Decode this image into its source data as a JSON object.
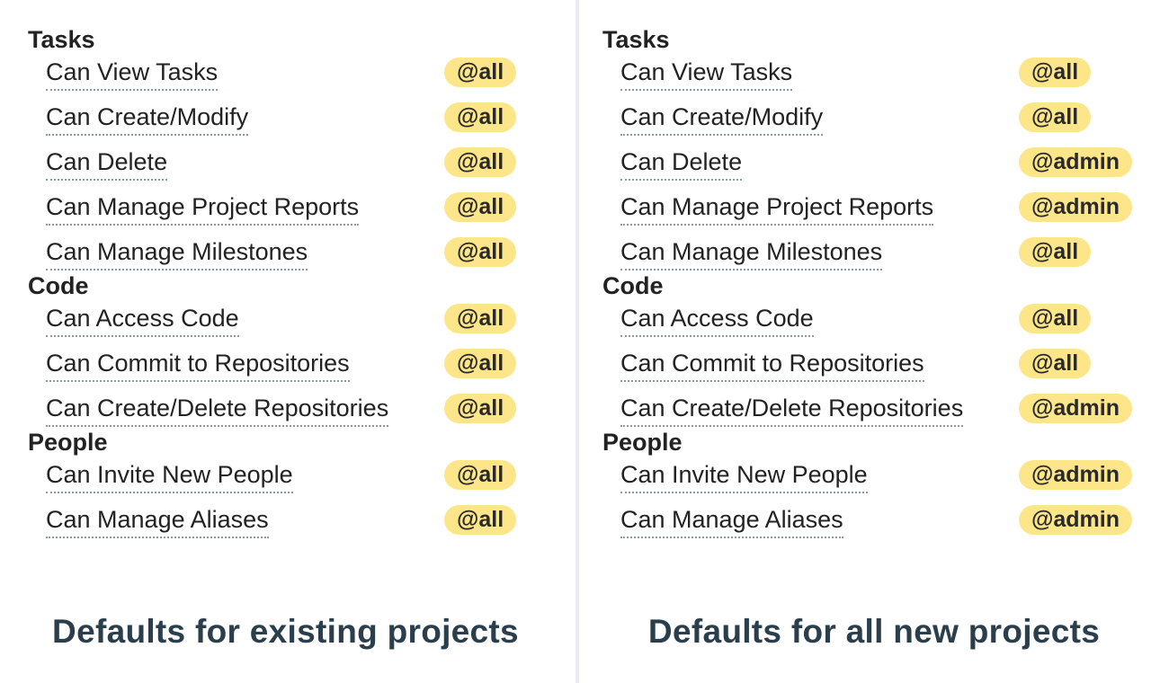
{
  "panels": [
    {
      "caption": "Defaults for existing projects",
      "groups": [
        {
          "title": "Tasks",
          "items": [
            {
              "label": "Can View Tasks",
              "value": "@all"
            },
            {
              "label": "Can Create/Modify",
              "value": "@all"
            },
            {
              "label": "Can Delete",
              "value": "@all"
            },
            {
              "label": "Can Manage Project Reports",
              "value": "@all"
            },
            {
              "label": "Can Manage Milestones",
              "value": "@all"
            }
          ]
        },
        {
          "title": "Code",
          "items": [
            {
              "label": "Can Access Code",
              "value": "@all"
            },
            {
              "label": "Can Commit to Repositories",
              "value": "@all"
            },
            {
              "label": "Can Create/Delete Repositories",
              "value": "@all"
            }
          ]
        },
        {
          "title": "People",
          "items": [
            {
              "label": "Can Invite New People",
              "value": "@all"
            },
            {
              "label": "Can Manage Aliases",
              "value": "@all"
            }
          ]
        }
      ]
    },
    {
      "caption": "Defaults for all new projects",
      "groups": [
        {
          "title": "Tasks",
          "items": [
            {
              "label": "Can View Tasks",
              "value": "@all"
            },
            {
              "label": "Can Create/Modify",
              "value": "@all"
            },
            {
              "label": "Can Delete",
              "value": "@admin"
            },
            {
              "label": "Can Manage Project Reports",
              "value": "@admin"
            },
            {
              "label": "Can Manage Milestones",
              "value": "@all"
            }
          ]
        },
        {
          "title": "Code",
          "items": [
            {
              "label": "Can Access Code",
              "value": "@all"
            },
            {
              "label": "Can Commit to Repositories",
              "value": "@all"
            },
            {
              "label": "Can Create/Delete Repositories",
              "value": "@admin"
            }
          ]
        },
        {
          "title": "People",
          "items": [
            {
              "label": "Can Invite New People",
              "value": "@admin"
            },
            {
              "label": "Can Manage Aliases",
              "value": "@admin"
            }
          ]
        }
      ]
    }
  ],
  "colors": {
    "badge_bg": "#fde68a",
    "caption": "#2b3e4c",
    "divider": "#ececf2",
    "underline": "#8a9aa6"
  }
}
